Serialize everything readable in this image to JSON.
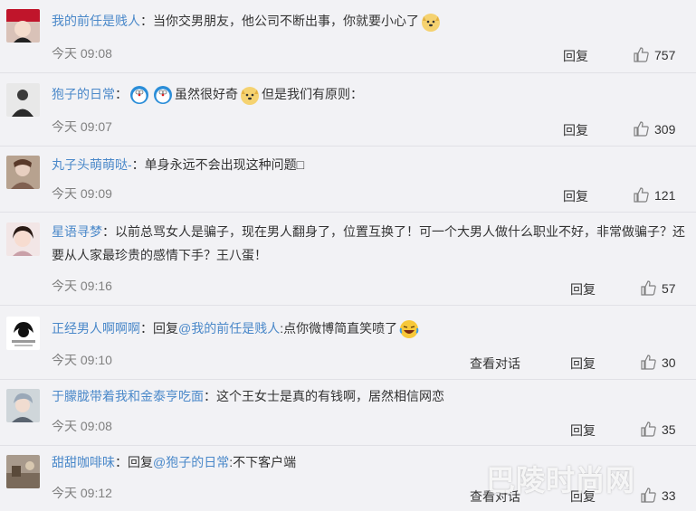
{
  "comments": [
    {
      "user": "我的前任是贱人",
      "text": "：当你交男朋友，他公司不断出事，你就要小心了",
      "time": "今天 09:08",
      "reply": "回复",
      "likes": "757"
    },
    {
      "user": "狍子的日常",
      "text_a": "：",
      "text_b": "虽然很好奇",
      "text_c": "但是我们有原则：",
      "time": "今天 09:07",
      "reply": "回复",
      "likes": "309"
    },
    {
      "user": "丸子头萌萌哒-",
      "text": "：单身永远不会出现这种问题□",
      "time": "今天 09:09",
      "reply": "回复",
      "likes": "121"
    },
    {
      "user": "星语寻梦",
      "text": "：以前总骂女人是骗子，现在男人翻身了，位置互换了！可一个大男人做什么职业不好，非常做骗子？还要从人家最珍贵的感情下手？王八蛋！",
      "time": "今天 09:16",
      "reply": "回复",
      "likes": "57"
    },
    {
      "user": "正经男人啊啊啊",
      "text_a": "：回复",
      "mention": "@我的前任是贱人",
      "text_b": ":点你微博简直笑喷了",
      "time": "今天 09:10",
      "view": "查看对话",
      "reply": "回复",
      "likes": "30"
    },
    {
      "user": "于朦胧带着我和金泰亨吃面",
      "text": "：这个王女士是真的有钱啊，居然相信网恋",
      "time": "今天 09:08",
      "reply": "回复",
      "likes": "35"
    },
    {
      "user": "甜甜咖啡味",
      "text_a": "：回复",
      "mention": "@狍子的日常",
      "text_b": ":不下客户端",
      "time": "今天 09:12",
      "view": "查看对话",
      "reply": "回复",
      "likes": "33"
    }
  ],
  "watermark": "巴陵时尚网",
  "colors": {
    "name": "#4a88c9",
    "background": "#f2f2f5",
    "time": "#808080"
  }
}
